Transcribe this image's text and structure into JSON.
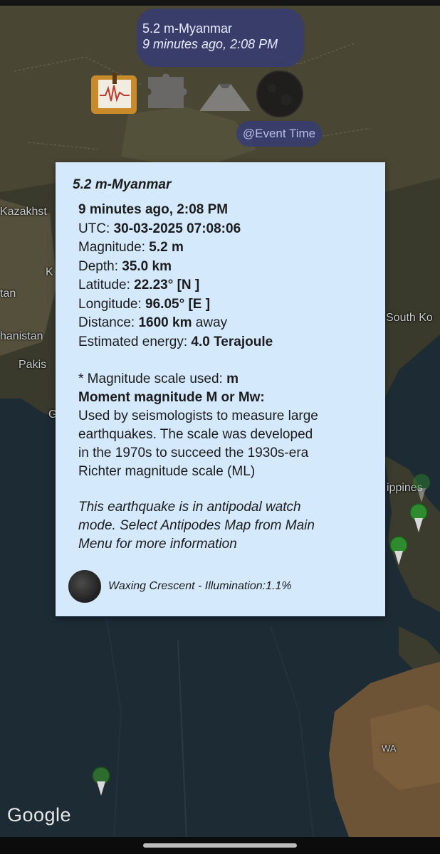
{
  "map": {
    "labels": {
      "kazakhstan": "Kazakhst",
      "k_fragment": "K",
      "stan_fragment": "tan",
      "afghanistan": "hanistan",
      "pakistan": "Pakis",
      "g_fragment": "G",
      "south_korea": "South Ko",
      "philippines": "ippines",
      "wa": "WA"
    },
    "attribution": "Google"
  },
  "event_bubble": {
    "title": "5.2 m-Myanmar",
    "time": "9 minutes ago, 2:08 PM"
  },
  "icons": {
    "seismograph": "seismograph-icon",
    "puzzle": "puzzle-icon",
    "volcano": "volcano-icon",
    "moon": "moon-icon"
  },
  "event_time_label": "@Event Time",
  "info": {
    "title": "5.2 m-Myanmar",
    "relative_time": "9 minutes ago, 2:08 PM",
    "utc_label": "UTC: ",
    "utc_value": "30-03-2025 07:08:06",
    "magnitude_label": "Magnitude: ",
    "magnitude_value": "5.2 m",
    "depth_label": "Depth: ",
    "depth_value": "35.0 km",
    "latitude_label": "Latitude: ",
    "latitude_value": "22.23° [N ]",
    "longitude_label": "Longitude: ",
    "longitude_value": "96.05° [E ]",
    "distance_label": "Distance: ",
    "distance_value": "1600 km",
    "distance_suffix": " away",
    "energy_label": "Estimated energy: ",
    "energy_value": "4.0 Terajoule",
    "scale_label": "* Magnitude scale used: ",
    "scale_value": "m",
    "moment_heading": "Moment magnitude M or Mw:",
    "moment_desc_1": "Used by seismologists to measure large",
    "moment_desc_2": "earthquakes. The scale was developed",
    "moment_desc_3": "in the 1970s to succeed the 1930s-era",
    "moment_desc_4": "Richter magnitude scale (ML)",
    "antipodal_1": "This earthquake is in antipodal watch",
    "antipodal_2": "mode. Select Antipodes Map from Main",
    "antipodal_3": "Menu for more information",
    "moon_phase": "Waxing Crescent - Illumination:1.1%"
  },
  "colors": {
    "panel_bg": "#d4e9fb",
    "bubble_bg": "#343c76",
    "pin_green": "#2e8b2e"
  }
}
